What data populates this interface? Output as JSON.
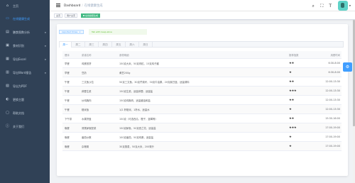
{
  "sidebar": {
    "items": [
      {
        "label": "主页",
        "icon": "home-icon",
        "has_arrow": false
      },
      {
        "label": "在线健康生成",
        "icon": "monitor-icon",
        "has_arrow": false,
        "active": true
      },
      {
        "label": "膳食图数分析",
        "icon": "chart-icon",
        "has_arrow": true
      },
      {
        "label": "食材识别",
        "icon": "scan-icon",
        "has_arrow": true
      },
      {
        "label": "导出Excel",
        "icon": "excel-icon",
        "has_arrow": true
      },
      {
        "label": "导出Word报告",
        "icon": "word-icon",
        "has_arrow": true
      },
      {
        "label": "导出为PDF",
        "icon": "pdf-icon",
        "has_arrow": false
      },
      {
        "label": "更换主题",
        "icon": "palette-icon",
        "has_arrow": false
      },
      {
        "label": "帮助文档",
        "icon": "document-icon",
        "has_arrow": false
      },
      {
        "label": "关于我们",
        "icon": "info-icon",
        "has_arrow": false
      }
    ]
  },
  "header": {
    "breadcrumb_root": "Dashboard",
    "breadcrumb_sep": "/",
    "breadcrumb_current": "在线健康生成"
  },
  "tags": {
    "items": [
      "主页",
      "用户主页",
      "在线健康生成"
    ]
  },
  "content": {
    "chip_label": "reported times",
    "chip_close": "×",
    "alert_text": "Tab with keep-alive",
    "tabs": [
      "周一",
      "周二",
      "周三",
      "周四",
      "周五",
      "周六",
      "周日"
    ],
    "columns": [
      "餐序",
      "菜谱名称",
      "食物明细",
      "推荐指数",
      "用餐时间"
    ],
    "rows": [
      {
        "meal": "早餐",
        "name": "鸡蛋煎饼",
        "detail": "150克大米，50克肉粒，15克鸡子酱",
        "stars": "★★",
        "time": "6:30-8:00"
      },
      {
        "meal": "早餐",
        "name": "豆奶",
        "detail": "黄豆200g",
        "stars": "★",
        "time": "6:30-8:00"
      },
      {
        "meal": "午餐",
        "name": "三文鱼沙拉",
        "detail": "50克三文鱼，30克芹菜秆，30克牛油果，20克紫甘蓝，适量调料",
        "stars": "★★",
        "time": "12:00-13:30"
      },
      {
        "meal": "午餐",
        "name": "蒜蓉生菜",
        "detail": "150克生菜，适量蒜蓉，适量盐",
        "stars": "★★★",
        "time": "12:00-13:30"
      },
      {
        "meal": "午餐",
        "name": "炒鸡胸肉",
        "detail": "150克鸡胸肉，适量酱油和盐",
        "stars": "★★",
        "time": "12:00-13:30"
      },
      {
        "meal": "午餐",
        "name": "糙米饭",
        "detail": "1/2 杯糙米，1杯水，适量水",
        "stars": "★",
        "time": "12:00-13:30"
      },
      {
        "meal": "下午茶",
        "name": "水果拼盘",
        "detail": "150克（可选西瓜，橙子，蓝莓等）",
        "stars": "★★",
        "time": "15:30-16:00"
      },
      {
        "meal": "晚餐",
        "name": "清蒸鲈鱼配菜",
        "detail": "150克鲈鱼，50克西兰花，适量盐",
        "stars": "★★★",
        "time": "17:00-19:00"
      },
      {
        "meal": "晚餐",
        "name": "番茄炒蛋",
        "detail": "100克番茄，50克鸡蛋，适量盐",
        "stars": "★",
        "time": "17:00-19:00"
      },
      {
        "meal": "晚餐",
        "name": "杂粮粥",
        "detail": "30克燕麦，50克大米，200毫升",
        "stars": "★",
        "time": "17:00-19:00"
      }
    ]
  },
  "colors": {
    "sidebar_bg": "#304156",
    "accent": "#409eff",
    "active_tag": "#42b983"
  }
}
